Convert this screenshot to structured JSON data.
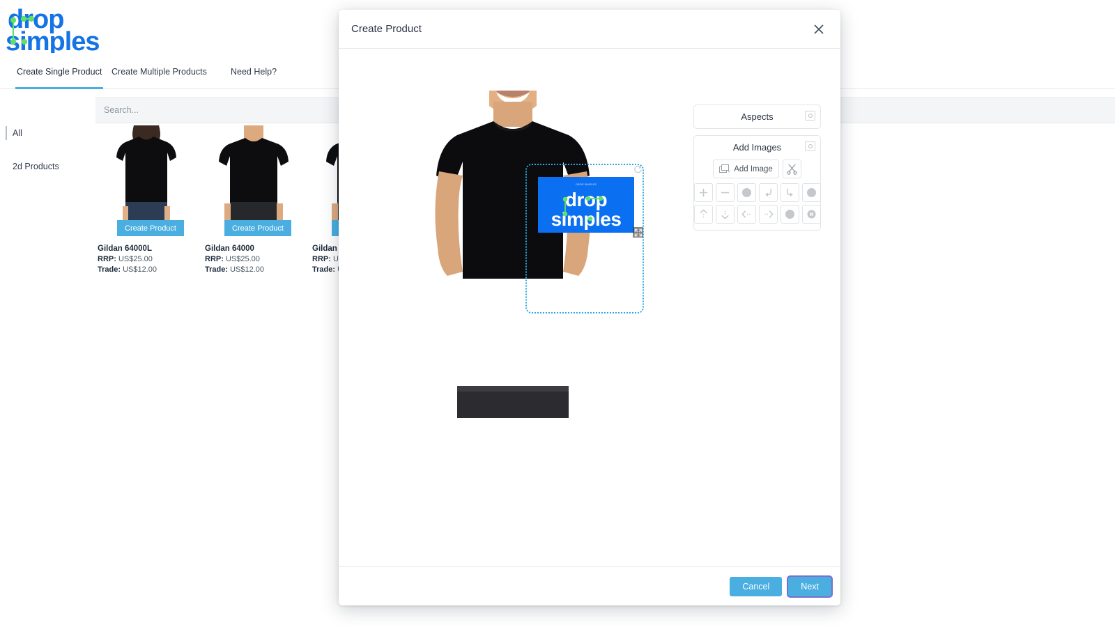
{
  "brand": {
    "line1": "drop",
    "line2": "simples",
    "blue": "#1573e6",
    "green": "#5ee06a"
  },
  "nav": {
    "tabs": [
      {
        "label": "Create Single Product",
        "active": true
      },
      {
        "label": "Create Multiple Products",
        "active": false
      },
      {
        "label": "Need Help?",
        "active": false
      }
    ]
  },
  "search": {
    "placeholder": "Search...",
    "value": ""
  },
  "sidebar": {
    "items": [
      {
        "label": "All",
        "active": true
      },
      {
        "label": "2d Products",
        "active": false
      }
    ]
  },
  "catalog": {
    "cta_label": "Create Product",
    "rrp_label": "RRP:",
    "trade_label": "Trade:",
    "products": [
      {
        "name": "Gildan 64000L",
        "rrp": "US$25.00",
        "trade": "US$12.00",
        "model": "female"
      },
      {
        "name": "Gildan 64000",
        "rrp": "US$25.00",
        "trade": "US$12.00",
        "model": "male"
      },
      {
        "name": "Gildan",
        "rrp": "US",
        "trade": "U",
        "model": "male"
      }
    ]
  },
  "modal": {
    "title": "Create Product",
    "close_icon": "close-icon",
    "footer": {
      "cancel_label": "Cancel",
      "next_label": "Next"
    },
    "panel": {
      "aspects": {
        "title": "Aspects",
        "camera_icon": "camera-icon"
      },
      "add_images": {
        "title": "Add Images",
        "camera_icon": "camera-icon",
        "add_image_label": "Add Image",
        "crop_icon": "scissors-icon",
        "tools": [
          {
            "icon": "plus-icon",
            "name": "zoom-in"
          },
          {
            "icon": "minus-icon",
            "name": "zoom-out"
          },
          {
            "icon": "circle-icon",
            "name": "color-swatch-1"
          },
          {
            "icon": "rotate-left-icon",
            "name": "rotate-left"
          },
          {
            "icon": "rotate-right-icon",
            "name": "rotate-right"
          },
          {
            "icon": "circle-icon",
            "name": "color-swatch-2"
          },
          {
            "icon": "arrow-up-icon",
            "name": "move-up"
          },
          {
            "icon": "arrow-down-icon",
            "name": "move-down"
          },
          {
            "icon": "arrow-left-icon",
            "name": "move-left"
          },
          {
            "icon": "arrow-right-icon",
            "name": "move-right"
          },
          {
            "icon": "circle-icon",
            "name": "color-swatch-3"
          },
          {
            "icon": "delete-circle-icon",
            "name": "remove-image"
          }
        ]
      }
    },
    "canvas": {
      "garment": "black t-shirt on male model",
      "artwork_text_1": "drop",
      "artwork_text_2": "simples",
      "artwork_color": "#0a6ff0",
      "selection_color": "#29a8e0",
      "rotate_handle_icon": "rotate-handle-icon",
      "resize_handle_icon": "resize-handle-icon"
    }
  }
}
